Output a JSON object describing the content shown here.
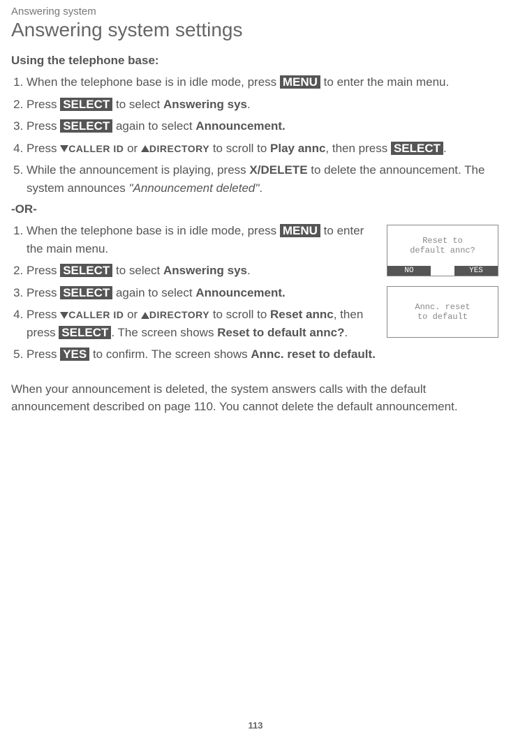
{
  "breadcrumb": "Answering system",
  "title": "Answering system settings",
  "sectionA": {
    "heading": "Using the telephone base:",
    "steps": {
      "s1a": "When the telephone base is in idle mode, press ",
      "s1_menu": "MENU",
      "s1b": " to enter the main menu.",
      "s2a": "Press ",
      "s2_select": "SELECT",
      "s2b": " to select ",
      "s2_bold": "Answering sys",
      "s2c": ".",
      "s3a": "Press ",
      "s3_select": "SELECT",
      "s3b": " again to select ",
      "s3_bold": "Announcement.",
      "s4a": "Press ",
      "s4_caller": "CALLER ID",
      "s4b": " or ",
      "s4_dir": "DIRECTORY",
      "s4c": " to scroll to ",
      "s4_bold": "Play annc",
      "s4d": ", then press ",
      "s4_select": "SELECT",
      "s4e": ".",
      "s5a": "While the announcement is playing, press ",
      "s5_bold1": "X/DELETE",
      "s5b": " to delete the announcement. The system announces ",
      "s5_italic": "\"Announcement deleted\"",
      "s5c": "."
    }
  },
  "or": "-OR-",
  "sectionB": {
    "steps": {
      "s1a": "When the telephone base is in idle mode, press ",
      "s1_menu": "MENU",
      "s1b": " to enter the main menu.",
      "s2a": "Press ",
      "s2_select": "SELECT",
      "s2b": " to select ",
      "s2_bold": "Answering sys",
      "s2c": ".",
      "s3a": "Press ",
      "s3_select": "SELECT",
      "s3b": " again to select ",
      "s3_bold": "Announcement.",
      "s4a": "Press ",
      "s4_caller": "CALLER ID",
      "s4b": " or ",
      "s4_dir": "DIRECTORY",
      "s4c": " to scroll to ",
      "s4_bold1": "Reset annc",
      "s4d": ", then press ",
      "s4_select": "SELECT",
      "s4e": ". The screen shows ",
      "s4_bold2": "Reset to default annc?",
      "s4f": ".",
      "s5a": "Press ",
      "s5_yes": "YES",
      "s5b": " to confirm. The screen shows ",
      "s5_bold": "Annc. reset to default."
    }
  },
  "screens": {
    "screen1": {
      "line1": "Reset to",
      "line2": "default annc?",
      "btnLeft": "NO",
      "btnRight": "YES"
    },
    "screen2": {
      "line1": "Annc. reset",
      "line2": "to default"
    }
  },
  "bottomPara": "When your announcement is deleted, the system answers calls with the default announcement described on page 110. You cannot delete the default announcement.",
  "pageNum": "113"
}
